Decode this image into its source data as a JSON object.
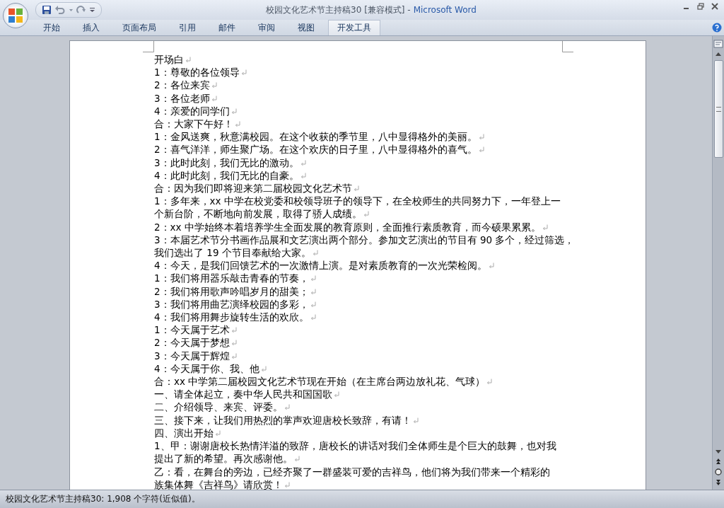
{
  "window": {
    "title": "校园文化艺术节主持稿30 [兼容模式] -",
    "app_name": "Microsoft Word"
  },
  "tabs": [
    {
      "label": "开始",
      "selected": false
    },
    {
      "label": "插入",
      "selected": false
    },
    {
      "label": "页面布局",
      "selected": false
    },
    {
      "label": "引用",
      "selected": false
    },
    {
      "label": "邮件",
      "selected": false
    },
    {
      "label": "审阅",
      "selected": false
    },
    {
      "label": "视图",
      "selected": false
    },
    {
      "label": "开发工具",
      "selected": true
    }
  ],
  "document": {
    "paragraphs": [
      {
        "lines": [
          "开场白"
        ]
      },
      {
        "lines": [
          "1：尊敬的各位领导"
        ]
      },
      {
        "lines": [
          "2：各位来宾"
        ]
      },
      {
        "lines": [
          "3：各位老师"
        ]
      },
      {
        "lines": [
          "4：亲爱的同学们"
        ]
      },
      {
        "lines": [
          "合：大家下午好！"
        ]
      },
      {
        "lines": [
          "1：金风送爽，秋意满校园。在这个收获的季节里，八中显得格外的美丽。"
        ]
      },
      {
        "lines": [
          "2：喜气洋洋，师生聚广场。在这个欢庆的日子里，八中显得格外的喜气。"
        ]
      },
      {
        "lines": [
          "3：此时此刻，我们无比的激动。"
        ]
      },
      {
        "lines": [
          "4：此时此刻，我们无比的自豪。"
        ]
      },
      {
        "lines": [
          "合：因为我们即将迎来第二届校园文化艺术节"
        ]
      },
      {
        "lines": [
          "1：多年来，xx 中学在校党委和校领导班子的领导下，在全校师生的共同努力下，一年登上一",
          "个新台阶，不断地向前发展，取得了骄人成绩。"
        ]
      },
      {
        "lines": [
          "2：xx 中学始终本着培养学生全面发展的教育原则，全面推行素质教育，而今硕果累累。"
        ]
      },
      {
        "lines": [
          "3：本届艺术节分书画作品展和文艺演出两个部分。参加文艺演出的节目有 90 多个，经过筛选，",
          "我们选出了 19 个节目奉献给大家。"
        ]
      },
      {
        "lines": [
          "4：今天，是我们回馈艺术的一次激情上演。是对素质教育的一次光荣检阅。"
        ]
      },
      {
        "lines": [
          "1：我们将用器乐敲击青春的节奏，"
        ]
      },
      {
        "lines": [
          "2：我们将用歌声吟唱岁月的甜美；"
        ]
      },
      {
        "lines": [
          "3：我们将用曲艺演绎校园的多彩，"
        ]
      },
      {
        "lines": [
          "4：我们将用舞步旋转生活的欢欣。"
        ]
      },
      {
        "lines": [
          "1：今天属于艺术"
        ]
      },
      {
        "lines": [
          "2：今天属于梦想"
        ]
      },
      {
        "lines": [
          "3：今天属于辉煌"
        ]
      },
      {
        "lines": [
          "4：今天属于你、我、他"
        ]
      },
      {
        "lines": [
          "合：xx 中学第二届校园文化艺术节现在开始（在主席台两边放礼花、气球）"
        ]
      },
      {
        "lines": [
          "一、请全体起立，奏中华人民共和国国歌"
        ]
      },
      {
        "lines": [
          "二、介绍领导、来宾、评委。"
        ]
      },
      {
        "lines": [
          "三、接下来，让我们用热烈的掌声欢迎唐校长致辞，有请！"
        ]
      },
      {
        "lines": [
          "四、演出开始"
        ]
      },
      {
        "lines": [
          "1、甲：谢谢唐校长热情洋溢的致辞，唐校长的讲话对我们全体师生是个巨大的鼓舞，也对我",
          "提出了新的希望。再次感谢他。"
        ]
      },
      {
        "lines": [
          "乙：看，在舞台的旁边，已经齐聚了一群盛装可爱的吉祥鸟，他们将为我们带来一个精彩的",
          "族集体舞《吉祥鸟》请欣赏！"
        ]
      }
    ]
  },
  "status_bar": {
    "text": "校园文化艺术节主持稿30: 1,908 个字符(近似值)。"
  }
}
